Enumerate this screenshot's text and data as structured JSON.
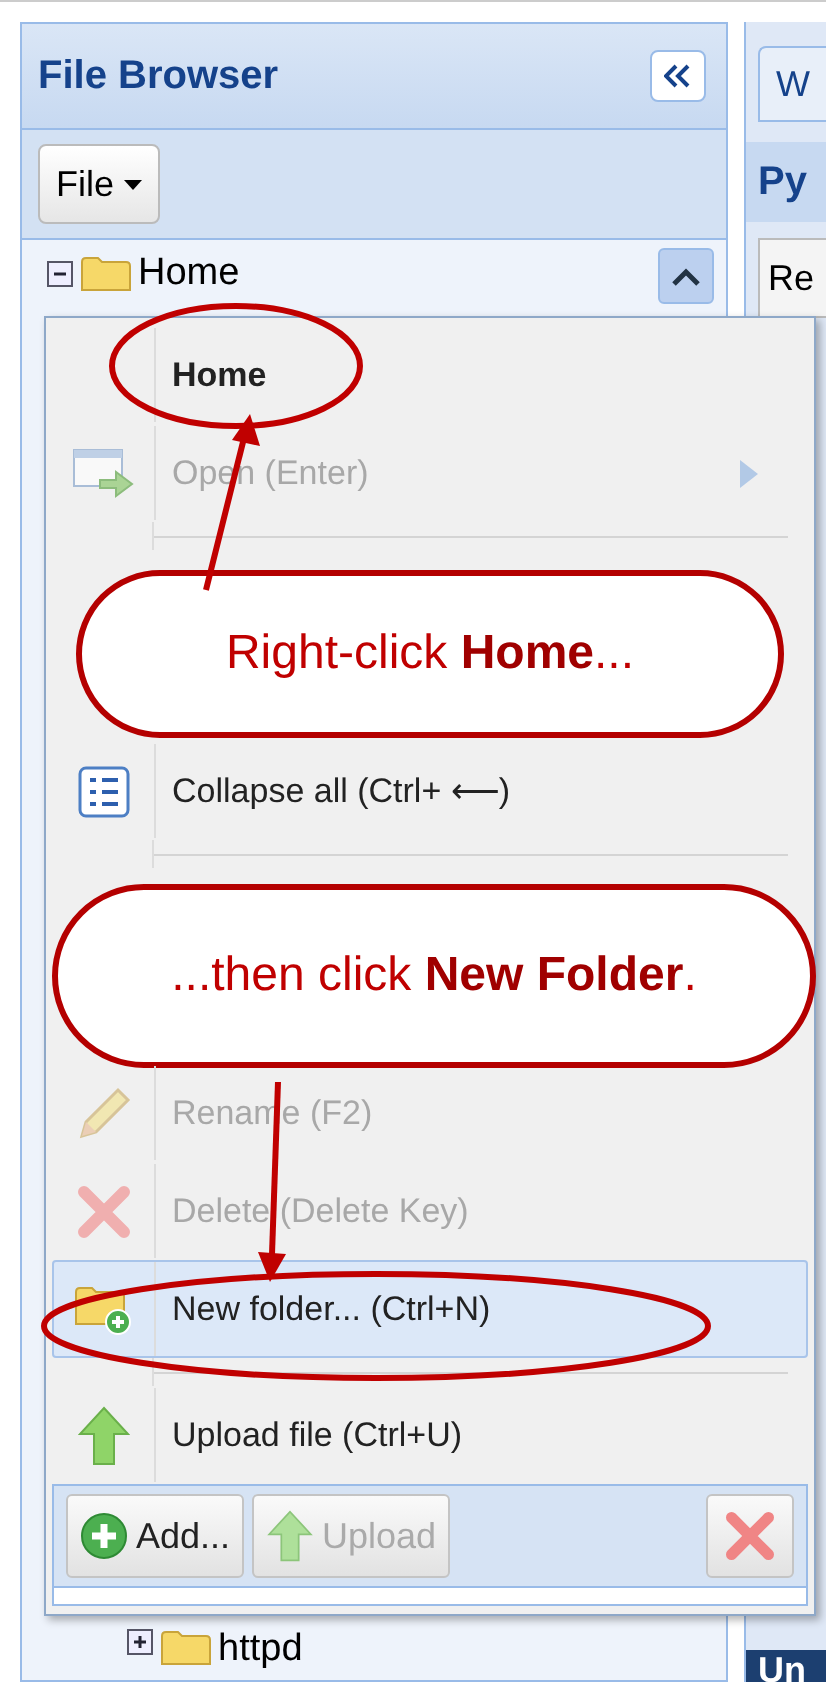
{
  "left_panel": {
    "title": "File Browser",
    "file_button": "File",
    "tree": [
      {
        "label": "Home",
        "expanded": true
      }
    ],
    "tree_below": [
      {
        "label": "httpd",
        "expanded": false
      }
    ]
  },
  "right_panel": {
    "tab": "W",
    "heading": "Py",
    "button": "Re",
    "footer": "Un"
  },
  "context_menu": {
    "entries": [
      {
        "kind": "header",
        "label": "Home"
      },
      {
        "kind": "item",
        "label": "Open (Enter)",
        "disabled": true,
        "selected": false,
        "submenu": true
      },
      {
        "kind": "separator"
      },
      {
        "kind": "callout",
        "text": "Right-click **Home**..."
      },
      {
        "kind": "item",
        "label": "Collapse all (Ctrl+ ⟵)",
        "disabled": false,
        "selected": false
      },
      {
        "kind": "separator"
      },
      {
        "kind": "callout",
        "text": "...then click **New Folder**."
      },
      {
        "kind": "item",
        "label": "Rename (F2)",
        "disabled": true,
        "selected": false
      },
      {
        "kind": "item",
        "label": "Delete (Delete Key)",
        "disabled": true,
        "selected": false
      },
      {
        "kind": "item",
        "label": "New folder... (Ctrl+N)",
        "disabled": false,
        "selected": true
      },
      {
        "kind": "separator"
      },
      {
        "kind": "item",
        "label": "Upload file (Ctrl+U)",
        "disabled": false,
        "selected": false
      }
    ],
    "toolbar": [
      {
        "label": "Add...",
        "disabled": false
      },
      {
        "label": "Upload",
        "disabled": true
      }
    ]
  }
}
